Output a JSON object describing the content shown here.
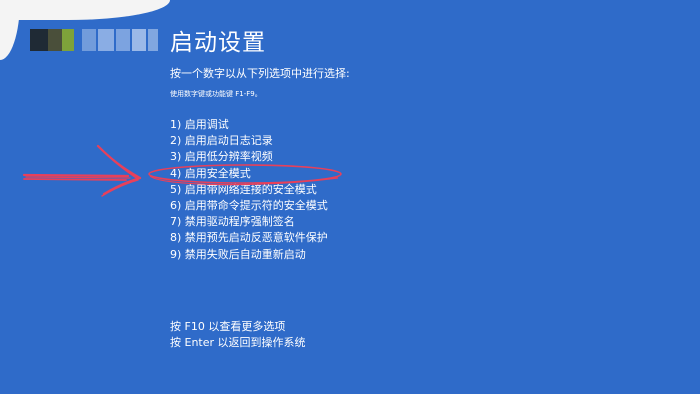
{
  "screen": {
    "title": "启动设置",
    "prompt": "按一个数字以从下列选项中进行选择:",
    "hint": "使用数字键或功能键 F1-F9。",
    "options": [
      "1) 启用调试",
      "2) 启用启动日志记录",
      "3) 启用低分辨率视频",
      "4) 启用安全模式",
      "5) 启用带网络连接的安全模式",
      "6) 启用带命令提示符的安全模式",
      "7) 禁用驱动程序强制签名",
      "8) 禁用预先启动反恶意软件保护",
      "9) 禁用失败后自动重新启动"
    ],
    "footer": {
      "more_options": "按 F10 以查看更多选项",
      "return": "按 Enter 以返回到操作系统"
    }
  },
  "colors": {
    "background": "#2f6bc9",
    "text": "#ffffff",
    "annotation": "#e8405a"
  },
  "annotation": {
    "highlighted_option": "4) 启用安全模式",
    "icons": [
      "red-arrow-icon",
      "red-ellipse-icon"
    ]
  }
}
